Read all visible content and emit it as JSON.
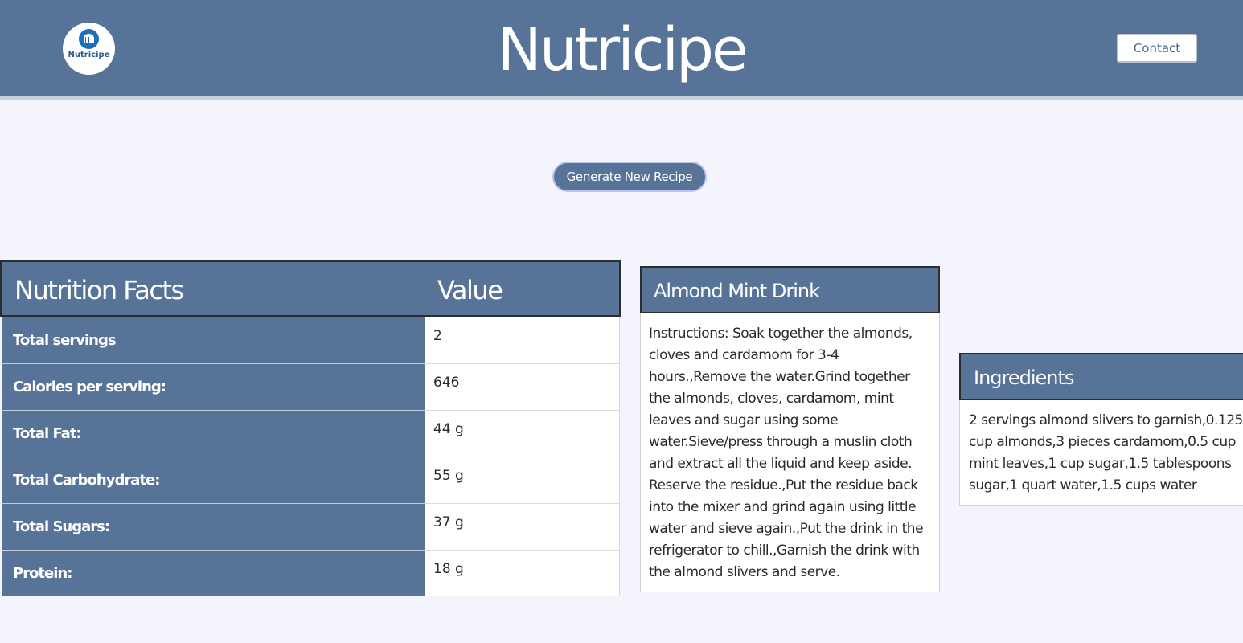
{
  "header": {
    "logo_text": "Nutricipe",
    "title": "Nutricipe",
    "contact_label": "Contact"
  },
  "actions": {
    "generate_label": "Generate New Recipe"
  },
  "nutrition": {
    "header_label": "Nutrition Facts",
    "header_value": "Value",
    "rows": [
      {
        "label": "Total servings",
        "value": "2"
      },
      {
        "label": "Calories per serving:",
        "value": "646"
      },
      {
        "label": "Total Fat:",
        "value": "44 g"
      },
      {
        "label": "Total Carbohydrate:",
        "value": "55 g"
      },
      {
        "label": "Total Sugars:",
        "value": "37 g"
      },
      {
        "label": "Protein:",
        "value": "18 g"
      }
    ]
  },
  "recipe": {
    "title": "Almond Mint Drink",
    "instructions": "Instructions: Soak together the almonds, cloves and cardamom for 3-4 hours.,Remove the water.Grind together the almonds, cloves, cardamom, mint leaves and sugar using some water.Sieve/press through a muslin cloth and extract all the liquid and keep aside. Reserve the residue.,Put the residue back into the mixer and grind again using little water and sieve again.,Put the drink in the refrigerator to chill.,Garnish the drink with the almond slivers and serve."
  },
  "ingredients": {
    "title": "Ingredients",
    "text": "2 servings almond slivers to garnish,0.125 cup almonds,3 pieces cardamom,0.5 cup mint leaves,1 cup sugar,1.5 tablespoons sugar,1 quart water,1.5 cups water"
  },
  "colors": {
    "header_bg": "#587398",
    "page_bg": "#f4f5fc",
    "logo_accent": "#1d6fb8"
  },
  "icons": {
    "logo": "chef-hat-icon"
  }
}
